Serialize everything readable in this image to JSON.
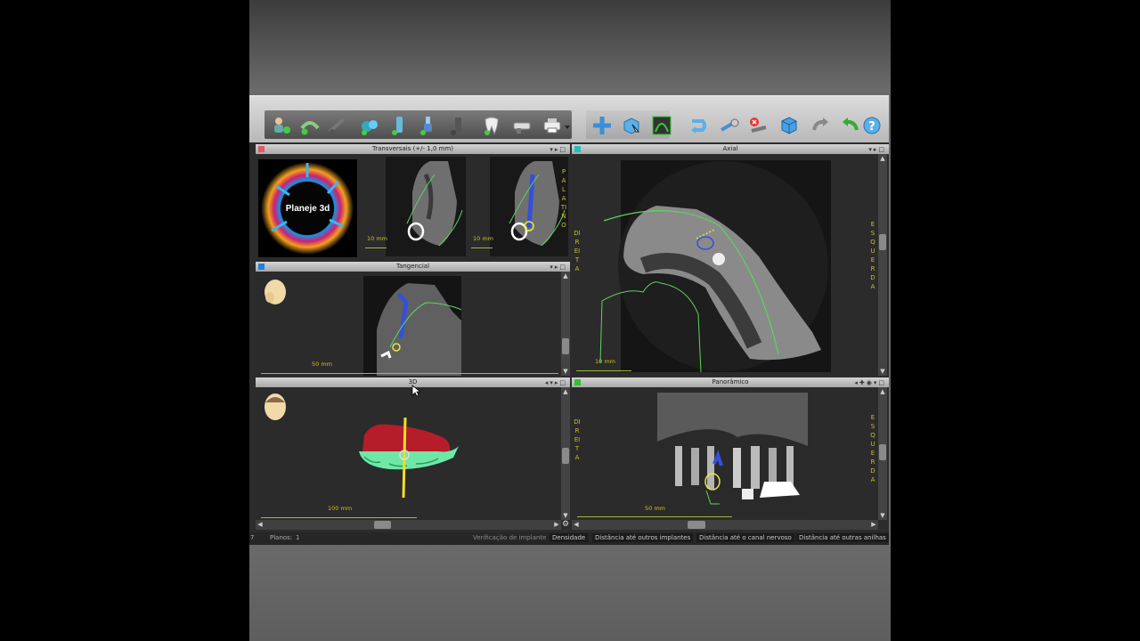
{
  "app": {
    "logo_text": "Planeje 3d",
    "colors": {
      "accent_green": "#5fd35f",
      "scale_yellow": "#c9c02a",
      "transversal_marker": "#e05a6a",
      "axial_marker": "#20c0c0",
      "tangencial_marker": "#2080e0",
      "panoramico_marker": "#30c030"
    }
  },
  "toolbar": {
    "buttons": [
      {
        "name": "patient-icon"
      },
      {
        "name": "arch-add-icon"
      },
      {
        "name": "nerve-icon"
      },
      {
        "name": "measure-icon"
      },
      {
        "name": "implant-icon"
      },
      {
        "name": "implant-abutment-icon"
      },
      {
        "name": "bar-icon"
      },
      {
        "name": "tooth-icon"
      },
      {
        "name": "sleeve-icon"
      },
      {
        "name": "printer-icon"
      },
      {
        "name": "move-cross-icon"
      },
      {
        "name": "cube-cursor-icon"
      },
      {
        "name": "panoramic-curve-icon"
      },
      {
        "name": "rotate-arrow-icon"
      },
      {
        "name": "wrench-icon"
      },
      {
        "name": "delete-tool-icon"
      },
      {
        "name": "cube-blue-icon"
      },
      {
        "name": "redo-icon"
      },
      {
        "name": "undo-icon"
      },
      {
        "name": "help-icon"
      }
    ]
  },
  "panes": {
    "transversal": {
      "title": "Transversais (+/- 1,0 mm)",
      "scale1": "10 mm",
      "scale2": "10 mm",
      "orient_right": "PALATINO"
    },
    "tangencial": {
      "title": "Tangencial",
      "scale": "50 mm"
    },
    "axial": {
      "title": "Axial",
      "scale": "10 mm",
      "orient_left": "DIREITA",
      "orient_right": "ESQUERDA"
    },
    "three_d": {
      "title": "3D",
      "scale": "100 mm"
    },
    "panoramico": {
      "title": "Panorâmico",
      "scale": "50 mm",
      "orient_left": "DIREITA",
      "orient_right": "ESQUERDA"
    }
  },
  "statusbar": {
    "left_num": "7",
    "planos_label": "Planos:",
    "planos_value": "1",
    "verificacao": "Verificação de implante",
    "densidade": "Densidade",
    "dist_implantes": "Distância até outros implantes",
    "dist_canal": "Distância até o canal nervoso",
    "dist_anilhas": "Distância até outras anilhas"
  }
}
